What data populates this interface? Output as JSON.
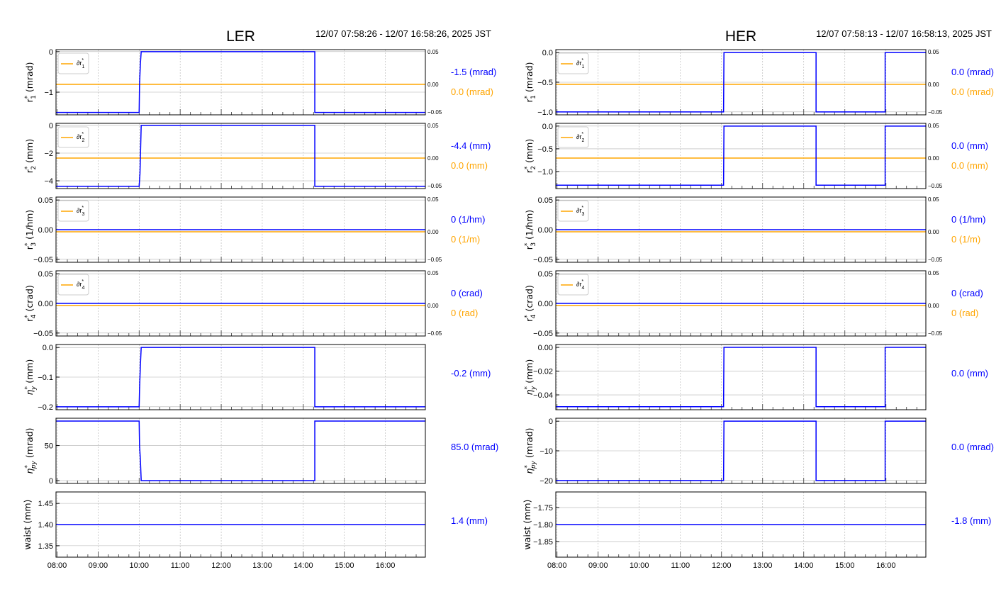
{
  "colors": {
    "blue": "#0000ff",
    "orange": "#ffa500",
    "grid": "#b0b0b0"
  },
  "chart_data": [
    {
      "type": "line",
      "title": "LER",
      "time_range": "12/07 07:58:26 - 12/07 16:58:26, 2025 JST",
      "xlim": [
        7.974,
        16.974
      ],
      "xticks": [
        8,
        9,
        10,
        11,
        12,
        13,
        14,
        15,
        16
      ],
      "xtick_labels": [
        "08:00",
        "09:00",
        "10:00",
        "11:00",
        "12:00",
        "13:00",
        "14:00",
        "15:00",
        "16:00"
      ],
      "subplots": [
        {
          "ylabel": {
            "base": "r",
            "sub": "1",
            "unit": "(mrad)"
          },
          "ylim": [
            -1.56,
            0.05
          ],
          "yticks": [
            0,
            -1
          ],
          "ytick_labels": [
            "0",
            "−1"
          ],
          "series": [
            [
              7.974,
              -1.5
            ],
            [
              10.0,
              -1.5
            ],
            [
              10.01,
              -0.8
            ],
            [
              10.03,
              -0.3
            ],
            [
              10.05,
              0
            ],
            [
              14.28,
              0
            ],
            [
              14.28,
              -1.5
            ],
            [
              16.974,
              -1.5
            ]
          ],
          "legend": {
            "base": "∂r",
            "sub": "1"
          },
          "right_ticks": [
            "0.05",
            "0.00",
            "−0.05"
          ],
          "value": "-1.5 (mrad)",
          "delta_value": "0.0 (mrad)"
        },
        {
          "ylabel": {
            "base": "r",
            "sub": "2",
            "unit": "(mm)"
          },
          "ylim": [
            -4.56,
            0.15
          ],
          "yticks": [
            0,
            -2,
            -4
          ],
          "ytick_labels": [
            "0",
            "−2",
            "−4"
          ],
          "series": [
            [
              7.974,
              -4.4
            ],
            [
              10.0,
              -4.4
            ],
            [
              10.02,
              -3.5
            ],
            [
              10.05,
              0
            ],
            [
              14.28,
              0
            ],
            [
              14.28,
              -4.4
            ],
            [
              16.974,
              -4.4
            ]
          ],
          "legend": {
            "base": "∂r",
            "sub": "2"
          },
          "right_ticks": [
            "0.05",
            "0.00",
            "−0.05"
          ],
          "value": "-4.4 (mm)",
          "delta_value": "0.0 (mm)"
        },
        {
          "ylabel": {
            "base": "r",
            "sub": "3",
            "unit": "(1/hm)"
          },
          "ylim": [
            -0.055,
            0.055
          ],
          "yticks": [
            0.05,
            0,
            -0.05
          ],
          "ytick_labels": [
            "0.05",
            "0.00",
            "−0.05"
          ],
          "series": [
            [
              7.974,
              0
            ],
            [
              16.974,
              0
            ]
          ],
          "legend": {
            "base": "∂r",
            "sub": "3"
          },
          "right_ticks": [
            "0.05",
            "0.00",
            "−0.05"
          ],
          "value": "0 (1/hm)",
          "delta_value": "0 (1/m)"
        },
        {
          "ylabel": {
            "base": "r",
            "sub": "4",
            "unit": "(crad)"
          },
          "ylim": [
            -0.055,
            0.055
          ],
          "yticks": [
            0.05,
            0,
            -0.05
          ],
          "ytick_labels": [
            "0.05",
            "0.00",
            "−0.05"
          ],
          "series": [
            [
              7.974,
              0
            ],
            [
              16.974,
              0
            ]
          ],
          "legend": {
            "base": "∂r",
            "sub": "4"
          },
          "right_ticks": [
            "0.05",
            "0.00",
            "−0.05"
          ],
          "value": "0 (crad)",
          "delta_value": "0 (rad)"
        },
        {
          "ylabel": {
            "base": "η",
            "sub": "y",
            "unit": "(mm)"
          },
          "ylim": [
            -0.21,
            0.01
          ],
          "yticks": [
            0,
            -0.1,
            -0.2
          ],
          "ytick_labels": [
            "0.0",
            "−0.1",
            "−0.2"
          ],
          "series": [
            [
              7.974,
              -0.2
            ],
            [
              10.0,
              -0.2
            ],
            [
              10.01,
              -0.14
            ],
            [
              10.03,
              -0.06
            ],
            [
              10.05,
              0
            ],
            [
              14.28,
              0
            ],
            [
              14.28,
              -0.2
            ],
            [
              16.974,
              -0.2
            ]
          ],
          "value": "-0.2 (mm)"
        },
        {
          "ylabel": {
            "base": "η",
            "sub": "py",
            "unit": "(mrad)"
          },
          "ylim": [
            -4,
            89
          ],
          "yticks": [
            50,
            0
          ],
          "ytick_labels": [
            "50",
            "0"
          ],
          "series": [
            [
              7.974,
              85
            ],
            [
              10.0,
              85
            ],
            [
              10.01,
              50
            ],
            [
              10.03,
              30
            ],
            [
              10.05,
              0
            ],
            [
              14.28,
              0
            ],
            [
              14.28,
              85
            ],
            [
              16.974,
              85
            ]
          ],
          "value": "85.0 (mrad)"
        },
        {
          "ylabel": {
            "base": "waist",
            "sub": "",
            "unit": "(mm)"
          },
          "ylim": [
            1.323,
            1.477
          ],
          "yticks": [
            1.45,
            1.4,
            1.35
          ],
          "ytick_labels": [
            "1.45",
            "1.40",
            "1.35"
          ],
          "series": [
            [
              7.974,
              1.4
            ],
            [
              16.974,
              1.4
            ]
          ],
          "value": "1.4 (mm)"
        }
      ]
    },
    {
      "type": "line",
      "title": "HER",
      "time_range": "12/07 07:58:13 - 12/07 16:58:13, 2025 JST",
      "xlim": [
        7.97,
        16.97
      ],
      "xticks": [
        8,
        9,
        10,
        11,
        12,
        13,
        14,
        15,
        16
      ],
      "xtick_labels": [
        "08:00",
        "09:00",
        "10:00",
        "11:00",
        "12:00",
        "13:00",
        "14:00",
        "15:00",
        "16:00"
      ],
      "subplots": [
        {
          "ylabel": {
            "base": "r",
            "sub": "1",
            "unit": "(mrad)"
          },
          "ylim": [
            -1.05,
            0.05
          ],
          "yticks": [
            0,
            -0.5,
            -1
          ],
          "ytick_labels": [
            "0.0",
            "−0.5",
            "−1.0"
          ],
          "series": [
            [
              7.97,
              -1
            ],
            [
              12.05,
              -1
            ],
            [
              12.06,
              0
            ],
            [
              14.3,
              0
            ],
            [
              14.3,
              -1
            ],
            [
              15.98,
              -1
            ],
            [
              15.98,
              0
            ],
            [
              16.97,
              0
            ]
          ],
          "legend": {
            "base": "∂r",
            "sub": "1"
          },
          "right_ticks": [
            "0.05",
            "0.00",
            "−0.05"
          ],
          "value": "0.0 (mrad)",
          "delta_value": "0.0 (mrad)"
        },
        {
          "ylabel": {
            "base": "r",
            "sub": "2",
            "unit": "(mm)"
          },
          "ylim": [
            -1.375,
            0.06
          ],
          "yticks": [
            0,
            -0.5,
            -1
          ],
          "ytick_labels": [
            "0.0",
            "−0.5",
            "−1.0"
          ],
          "series": [
            [
              7.97,
              -1.3
            ],
            [
              12.05,
              -1.3
            ],
            [
              12.06,
              0
            ],
            [
              14.3,
              0
            ],
            [
              14.3,
              -1.3
            ],
            [
              15.98,
              -1.3
            ],
            [
              15.98,
              0
            ],
            [
              16.97,
              0
            ]
          ],
          "legend": {
            "base": "∂r",
            "sub": "2"
          },
          "right_ticks": [
            "0.05",
            "0.00",
            "−0.05"
          ],
          "value": "0.0 (mm)",
          "delta_value": "0.0 (mm)"
        },
        {
          "ylabel": {
            "base": "r",
            "sub": "3",
            "unit": "(1/hm)"
          },
          "ylim": [
            -0.055,
            0.055
          ],
          "yticks": [
            0.05,
            0,
            -0.05
          ],
          "ytick_labels": [
            "0.05",
            "0.00",
            "−0.05"
          ],
          "series": [
            [
              7.97,
              0
            ],
            [
              16.97,
              0
            ]
          ],
          "legend": {
            "base": "∂r",
            "sub": "3"
          },
          "right_ticks": [
            "0.05",
            "0.00",
            "−0.05"
          ],
          "value": "0 (1/hm)",
          "delta_value": "0 (1/m)"
        },
        {
          "ylabel": {
            "base": "r",
            "sub": "4",
            "unit": "(crad)"
          },
          "ylim": [
            -0.055,
            0.055
          ],
          "yticks": [
            0.05,
            0,
            -0.05
          ],
          "ytick_labels": [
            "0.05",
            "0.00",
            "−0.05"
          ],
          "series": [
            [
              7.97,
              0
            ],
            [
              16.97,
              0
            ]
          ],
          "legend": {
            "base": "∂r",
            "sub": "4"
          },
          "right_ticks": [
            "0.05",
            "0.00",
            "−0.05"
          ],
          "value": "0 (crad)",
          "delta_value": "0 (rad)"
        },
        {
          "ylabel": {
            "base": "η",
            "sub": "y",
            "unit": "(mm)"
          },
          "ylim": [
            -0.0525,
            0.0024
          ],
          "yticks": [
            0,
            -0.02,
            -0.04
          ],
          "ytick_labels": [
            "0.00",
            "−0.02",
            "−0.04"
          ],
          "series": [
            [
              7.97,
              -0.05
            ],
            [
              12.05,
              -0.05
            ],
            [
              12.06,
              0
            ],
            [
              14.3,
              0
            ],
            [
              14.3,
              -0.05
            ],
            [
              15.98,
              -0.05
            ],
            [
              15.98,
              0
            ],
            [
              16.97,
              0
            ]
          ],
          "value": "0.0 (mm)"
        },
        {
          "ylabel": {
            "base": "η",
            "sub": "py",
            "unit": "(mrad)"
          },
          "ylim": [
            -21,
            1
          ],
          "yticks": [
            0,
            -10,
            -20
          ],
          "ytick_labels": [
            "0",
            "−10",
            "−20"
          ],
          "series": [
            [
              7.97,
              -20
            ],
            [
              12.05,
              -20
            ],
            [
              12.06,
              0
            ],
            [
              14.3,
              0
            ],
            [
              14.3,
              -20
            ],
            [
              15.98,
              -20
            ],
            [
              15.98,
              0
            ],
            [
              16.97,
              0
            ]
          ],
          "value": "0.0 (mrad)"
        },
        {
          "ylabel": {
            "base": "waist",
            "sub": "",
            "unit": "(mm)"
          },
          "ylim": [
            -1.896,
            -1.704
          ],
          "yticks": [
            -1.75,
            -1.8,
            -1.85
          ],
          "ytick_labels": [
            "−1.75",
            "−1.80",
            "−1.85"
          ],
          "series": [
            [
              7.97,
              -1.8
            ],
            [
              16.97,
              -1.8
            ]
          ],
          "value": "-1.8 (mm)"
        }
      ]
    }
  ]
}
